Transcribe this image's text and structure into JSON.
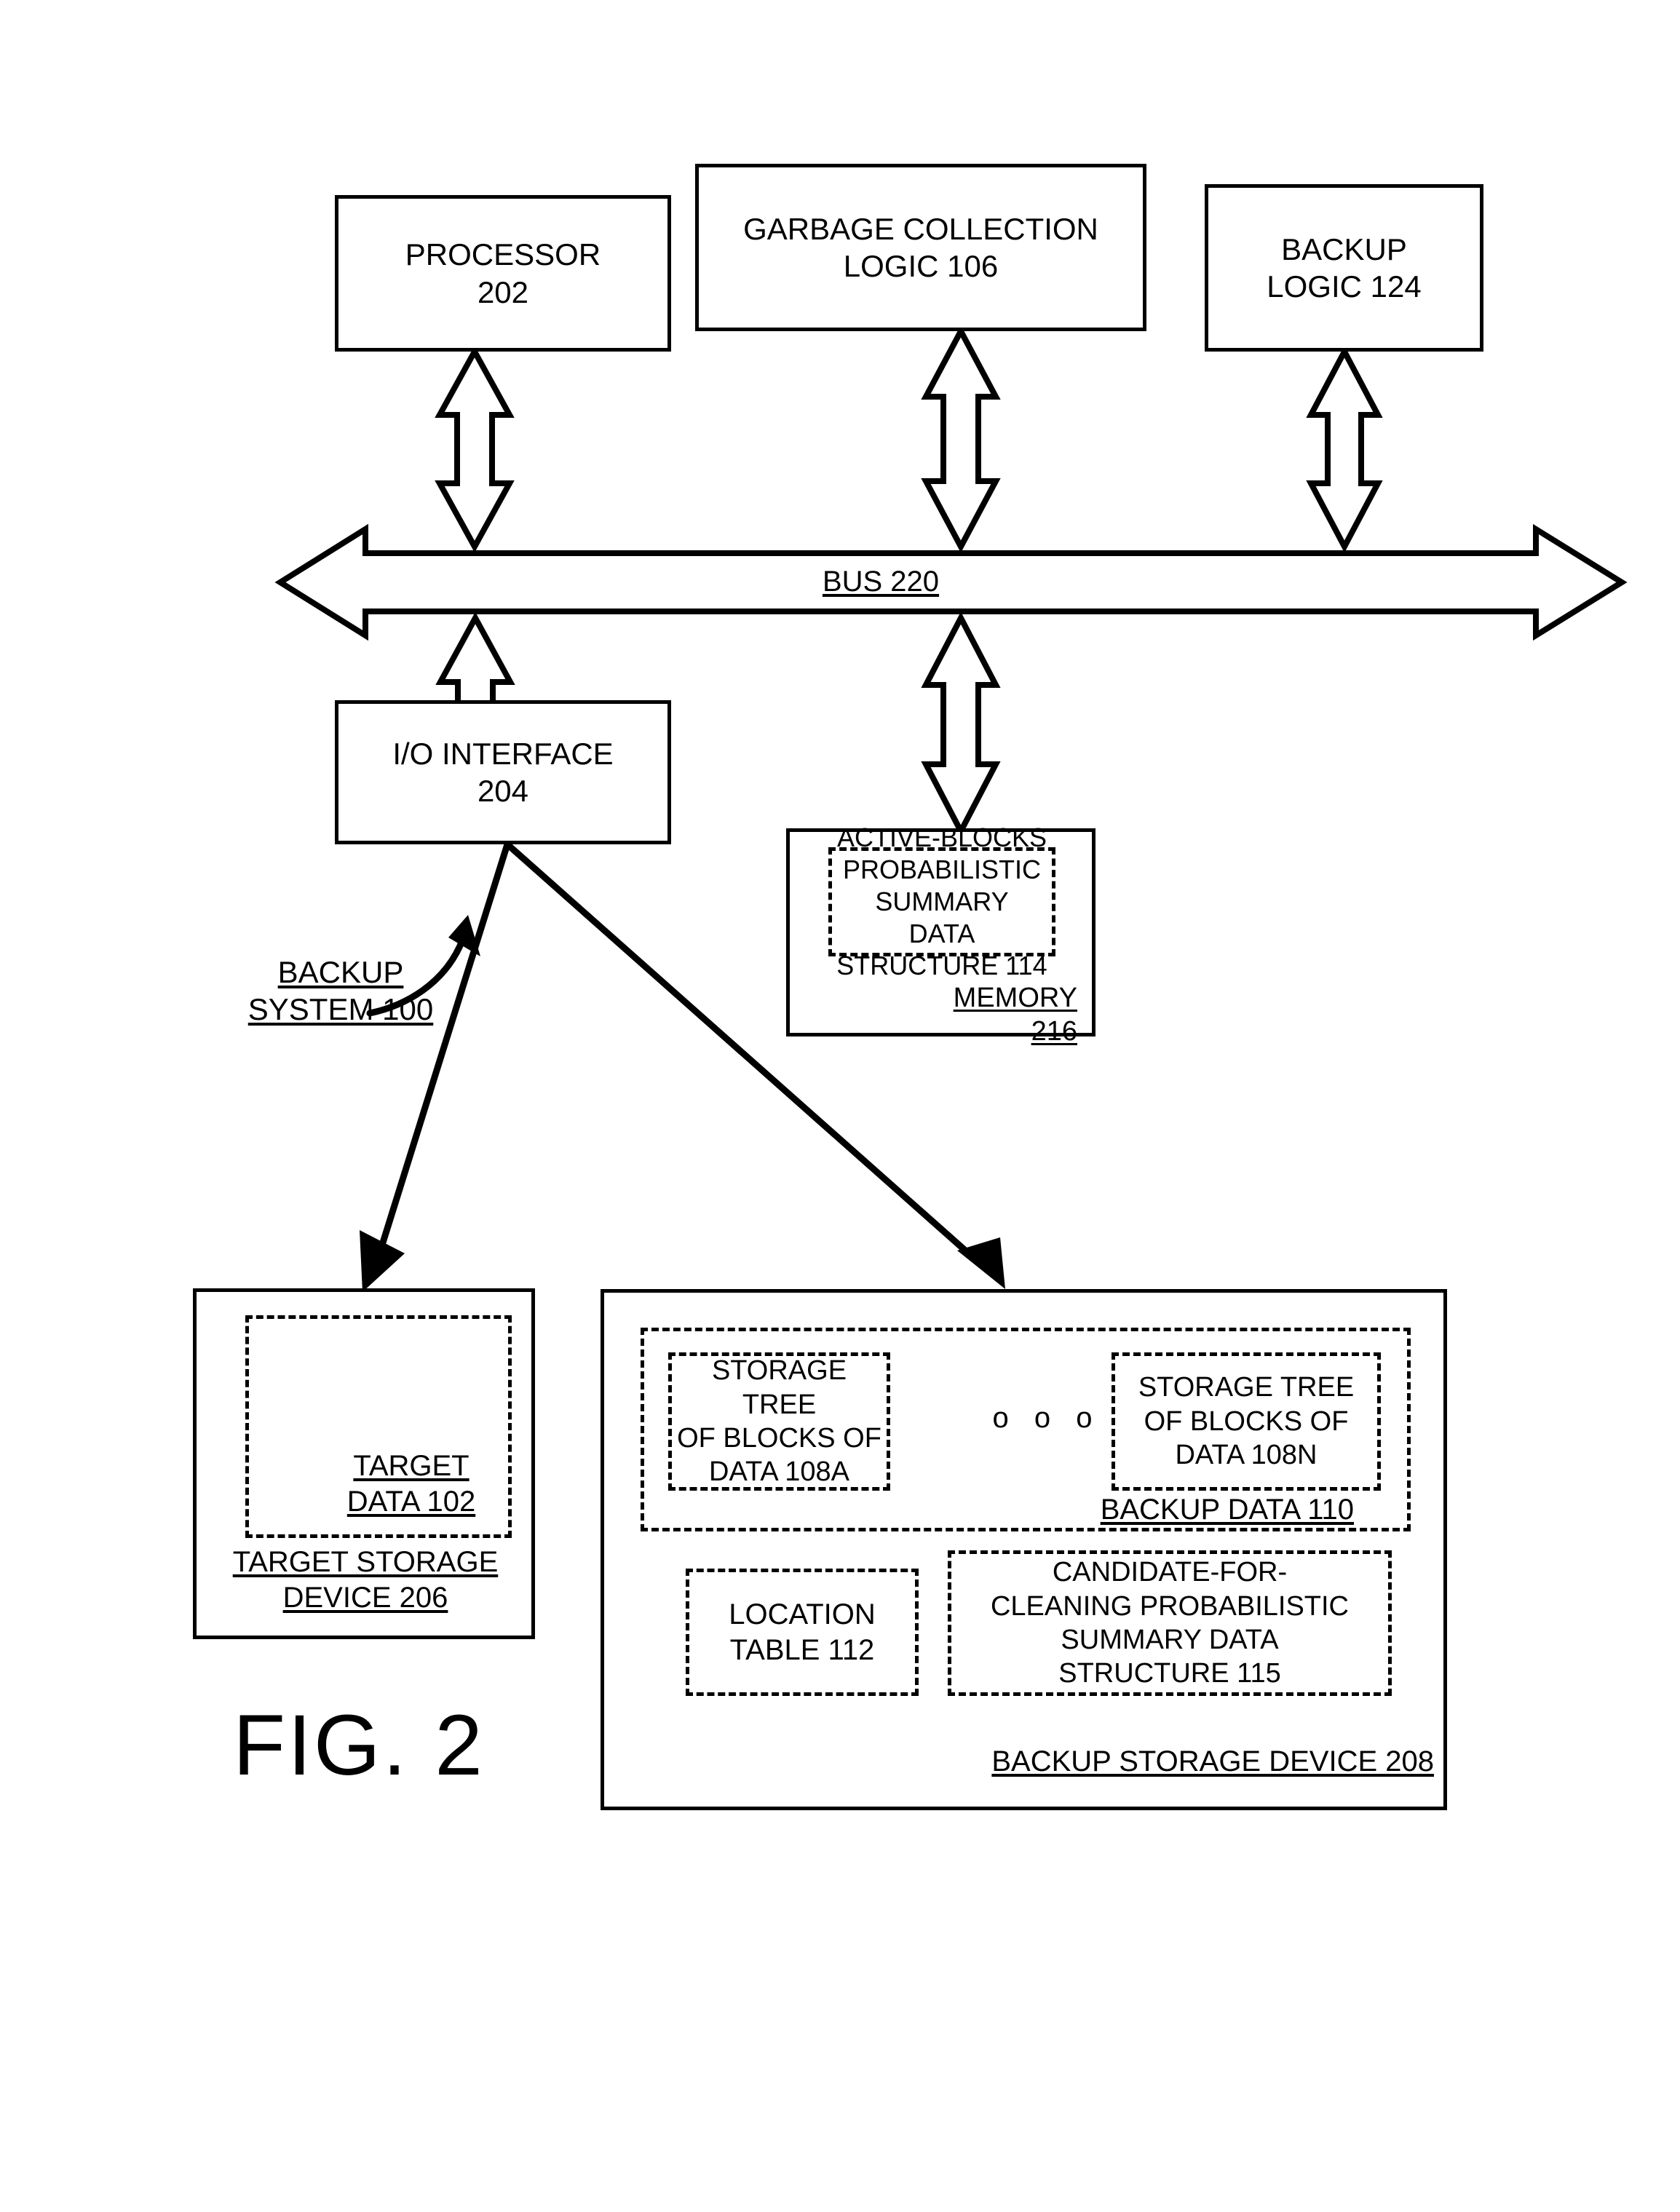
{
  "figure": {
    "label": "FIG. 2",
    "system_callout": "BACKUP\nSYSTEM 100"
  },
  "nodes": {
    "processor": "PROCESSOR\n202",
    "garbage_collection_logic": "GARBAGE COLLECTION\nLOGIC 106",
    "backup_logic": "BACKUP\nLOGIC 124",
    "bus": "BUS 220",
    "io_interface": "I/O INTERFACE\n204",
    "memory": "MEMORY 216",
    "active_blocks_structure": "ACTIVE-BLOCKS\nPROBABILISTIC SUMMARY\nDATA STRUCTURE 114",
    "target_storage_device": "TARGET STORAGE\nDEVICE 206",
    "target_data": "TARGET\nDATA 102",
    "backup_storage_device": "BACKUP STORAGE DEVICE 208",
    "backup_data": "BACKUP DATA 110",
    "storage_tree_a": "STORAGE TREE\nOF BLOCKS OF\nDATA 108A",
    "storage_tree_n": "STORAGE TREE\nOF BLOCKS OF\nDATA 108N",
    "ellipsis": "o o o",
    "location_table": "LOCATION\nTABLE 112",
    "candidate_for_cleaning_structure": "CANDIDATE-FOR-\nCLEANING PROBABILISTIC\nSUMMARY DATA\nSTRUCTURE 115"
  },
  "colors": {
    "stroke": "#000000",
    "background": "#ffffff"
  }
}
